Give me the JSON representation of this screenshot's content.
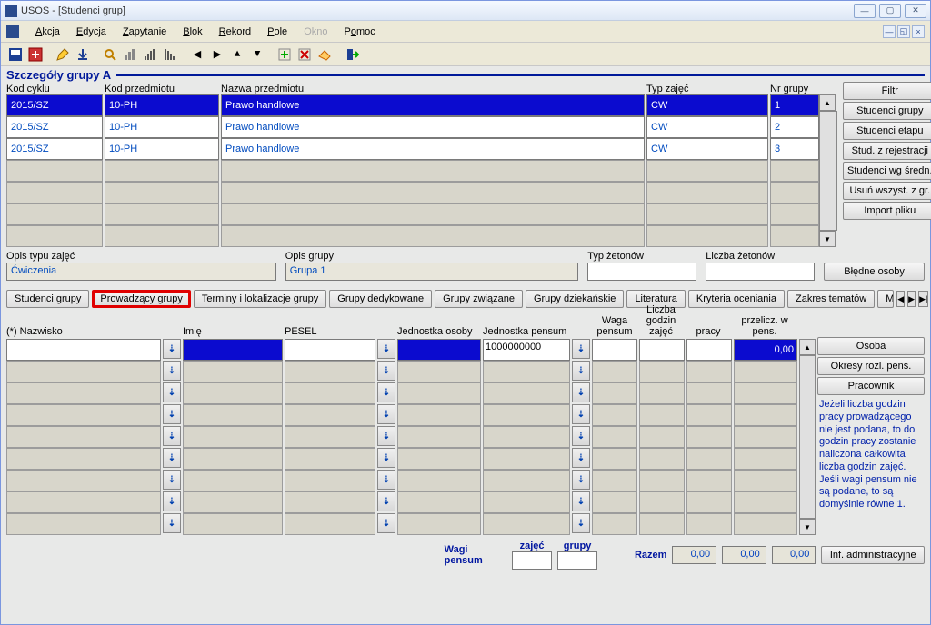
{
  "window": {
    "title": "USOS - [Studenci grup]"
  },
  "menu": {
    "akcja": "Akcja",
    "edycja": "Edycja",
    "zapytanie": "Zapytanie",
    "blok": "Blok",
    "rekord": "Rekord",
    "pole": "Pole",
    "okno": "Okno",
    "pomoc": "Pomoc"
  },
  "section": {
    "title": "Szczegóły grupy  A"
  },
  "grid": {
    "headers": {
      "kodc": "Kod cyklu",
      "kodp": "Kod przedmiotu",
      "nazwa": "Nazwa przedmiotu",
      "typ": "Typ zajęć",
      "nr": "Nr grupy"
    },
    "rows": [
      {
        "kodc": "2015/SZ",
        "kodp": "10-PH",
        "nazwa": "Prawo handlowe",
        "typ": "CW",
        "nr": "1",
        "selected": true
      },
      {
        "kodc": "2015/SZ",
        "kodp": "10-PH",
        "nazwa": "Prawo handlowe",
        "typ": "CW",
        "nr": "2",
        "selected": false
      },
      {
        "kodc": "2015/SZ",
        "kodp": "10-PH",
        "nazwa": "Prawo handlowe",
        "typ": "CW",
        "nr": "3",
        "selected": false
      }
    ]
  },
  "sidebtns": {
    "filtr": "Filtr",
    "sg": "Studenci grupy",
    "se": "Studenci etapu",
    "szr": "Stud. z rejestracji",
    "sws": "Studenci wg średn.",
    "uwz": "Usuń wszyst. z gr.",
    "imp": "Import pliku",
    "blo": "Błędne osoby"
  },
  "desc": {
    "opis_typu_label": "Opis typu zajęć",
    "opis_typu_val": "Ćwiczenia",
    "opis_grupy_label": "Opis grupy",
    "opis_grupy_val": "Grupa 1",
    "typ_zetonow": "Typ żetonów",
    "liczba_zetonow": "Liczba żetonów"
  },
  "tabs": {
    "t0": "Studenci grupy",
    "t1": "Prowadzący grupy",
    "t2": "Terminy i lokalizacje grupy",
    "t3": "Grupy dedykowane",
    "t4": "Grupy związane",
    "t5": "Grupy dziekańskie",
    "t6": "Literatura",
    "t7": "Kryteria oceniania",
    "t8": "Zakres tematów",
    "t9": "Meto"
  },
  "lower": {
    "headers": {
      "nazwisko": "(*) Nazwisko",
      "imie": "Imię",
      "pesel": "PESEL",
      "jo": "Jednostka osoby",
      "jp": "Jednostka pensum",
      "waga": "Waga pensum",
      "godz": "Liczba godzin zajęć",
      "pracy": "pracy",
      "prz": "przelicz. w pens."
    },
    "row0": {
      "jp": "1000000000",
      "prz": "0,00"
    }
  },
  "rightbtns": {
    "osoba": "Osoba",
    "orp": "Okresy rozl. pens.",
    "prac": "Pracownik",
    "inf": "Inf. administracyjne"
  },
  "info": "Jeżeli liczba godzin pracy prowadzącego nie jest podana, to do godzin pracy zostanie naliczona całkowita liczba godzin zajęć. Jeśli wagi pensum nie są podane, to są domyślnie równe 1.",
  "footer": {
    "zajec": "zajęć",
    "grupy": "grupy",
    "wagi": "Wagi pensum",
    "razem": "Razem",
    "r1": "0,00",
    "r2": "0,00",
    "r3": "0,00"
  }
}
